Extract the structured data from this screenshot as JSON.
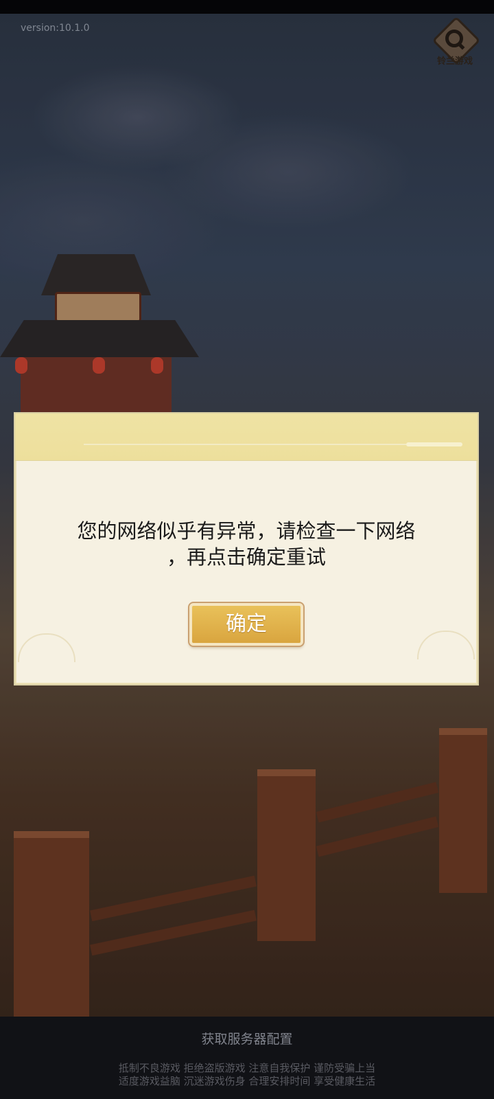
{
  "app": {
    "version": "version:10.1.0",
    "logo_text": "铃兰游戏"
  },
  "dialog": {
    "message": "您的网络似乎有异常，请检查一下网络\n，再点击确定重试",
    "confirm_label": "确定"
  },
  "footer": {
    "status": "获取服务器配置",
    "health_line1": "抵制不良游戏 拒绝盗版游戏 注意自我保护 谨防受骗上当",
    "health_line2": "适度游戏益脑 沉迷游戏伤身 合理安排时间 享受健康生活"
  },
  "colors": {
    "dialog_bg": "#f6f1e2",
    "dialog_header": "#eddf9c",
    "button": "#d9a53f"
  }
}
